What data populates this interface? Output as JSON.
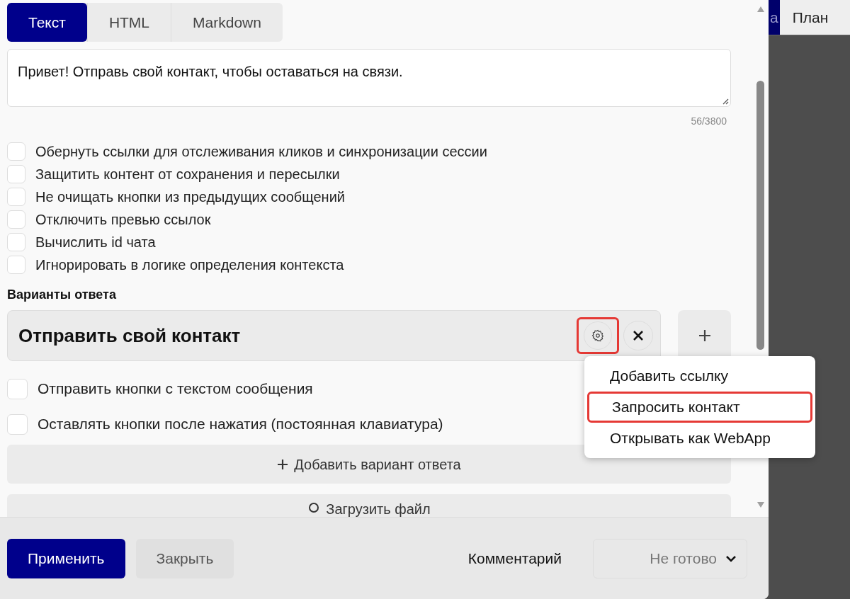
{
  "background_tabs": [
    {
      "label": "а",
      "selected": true
    },
    {
      "label": "План",
      "selected": false
    }
  ],
  "tabs": [
    {
      "label": "Текст",
      "selected": true
    },
    {
      "label": "HTML",
      "selected": false
    },
    {
      "label": "Markdown",
      "selected": false
    }
  ],
  "message": {
    "value": "Привет! Отправь свой контакт, чтобы оставаться на связи.",
    "counter": "56/3800"
  },
  "options": [
    {
      "label": "Обернуть ссылки для отслеживания кликов и синхронизации сессии",
      "checked": false
    },
    {
      "label": "Защитить контент от сохранения и пересылки",
      "checked": false
    },
    {
      "label": "Не очищать кнопки из предыдущих сообщений",
      "checked": false
    },
    {
      "label": "Отключить превью ссылок",
      "checked": false
    },
    {
      "label": "Вычислить id чата",
      "checked": false
    },
    {
      "label": "Игнорировать в логике определения контекста",
      "checked": false
    }
  ],
  "answers": {
    "title": "Варианты ответа",
    "items": [
      {
        "label": "Отправить свой контакт"
      }
    ],
    "menu": [
      {
        "label": "Добавить ссылку",
        "highlighted": false
      },
      {
        "label": "Запросить контакт",
        "highlighted": true
      },
      {
        "label": "Открывать как WebApp",
        "highlighted": false
      }
    ],
    "options": [
      {
        "label": "Отправить кнопки с текстом сообщения",
        "checked": false
      },
      {
        "label": "Оставлять кнопки после нажатия (постоянная клавиатура)",
        "checked": false
      }
    ],
    "add_button": "Добавить вариант ответа",
    "upload_button": "Загрузить файл"
  },
  "footer": {
    "apply": "Применить",
    "close": "Закрыть",
    "comment": "Комментарий",
    "status": "Не готово"
  }
}
